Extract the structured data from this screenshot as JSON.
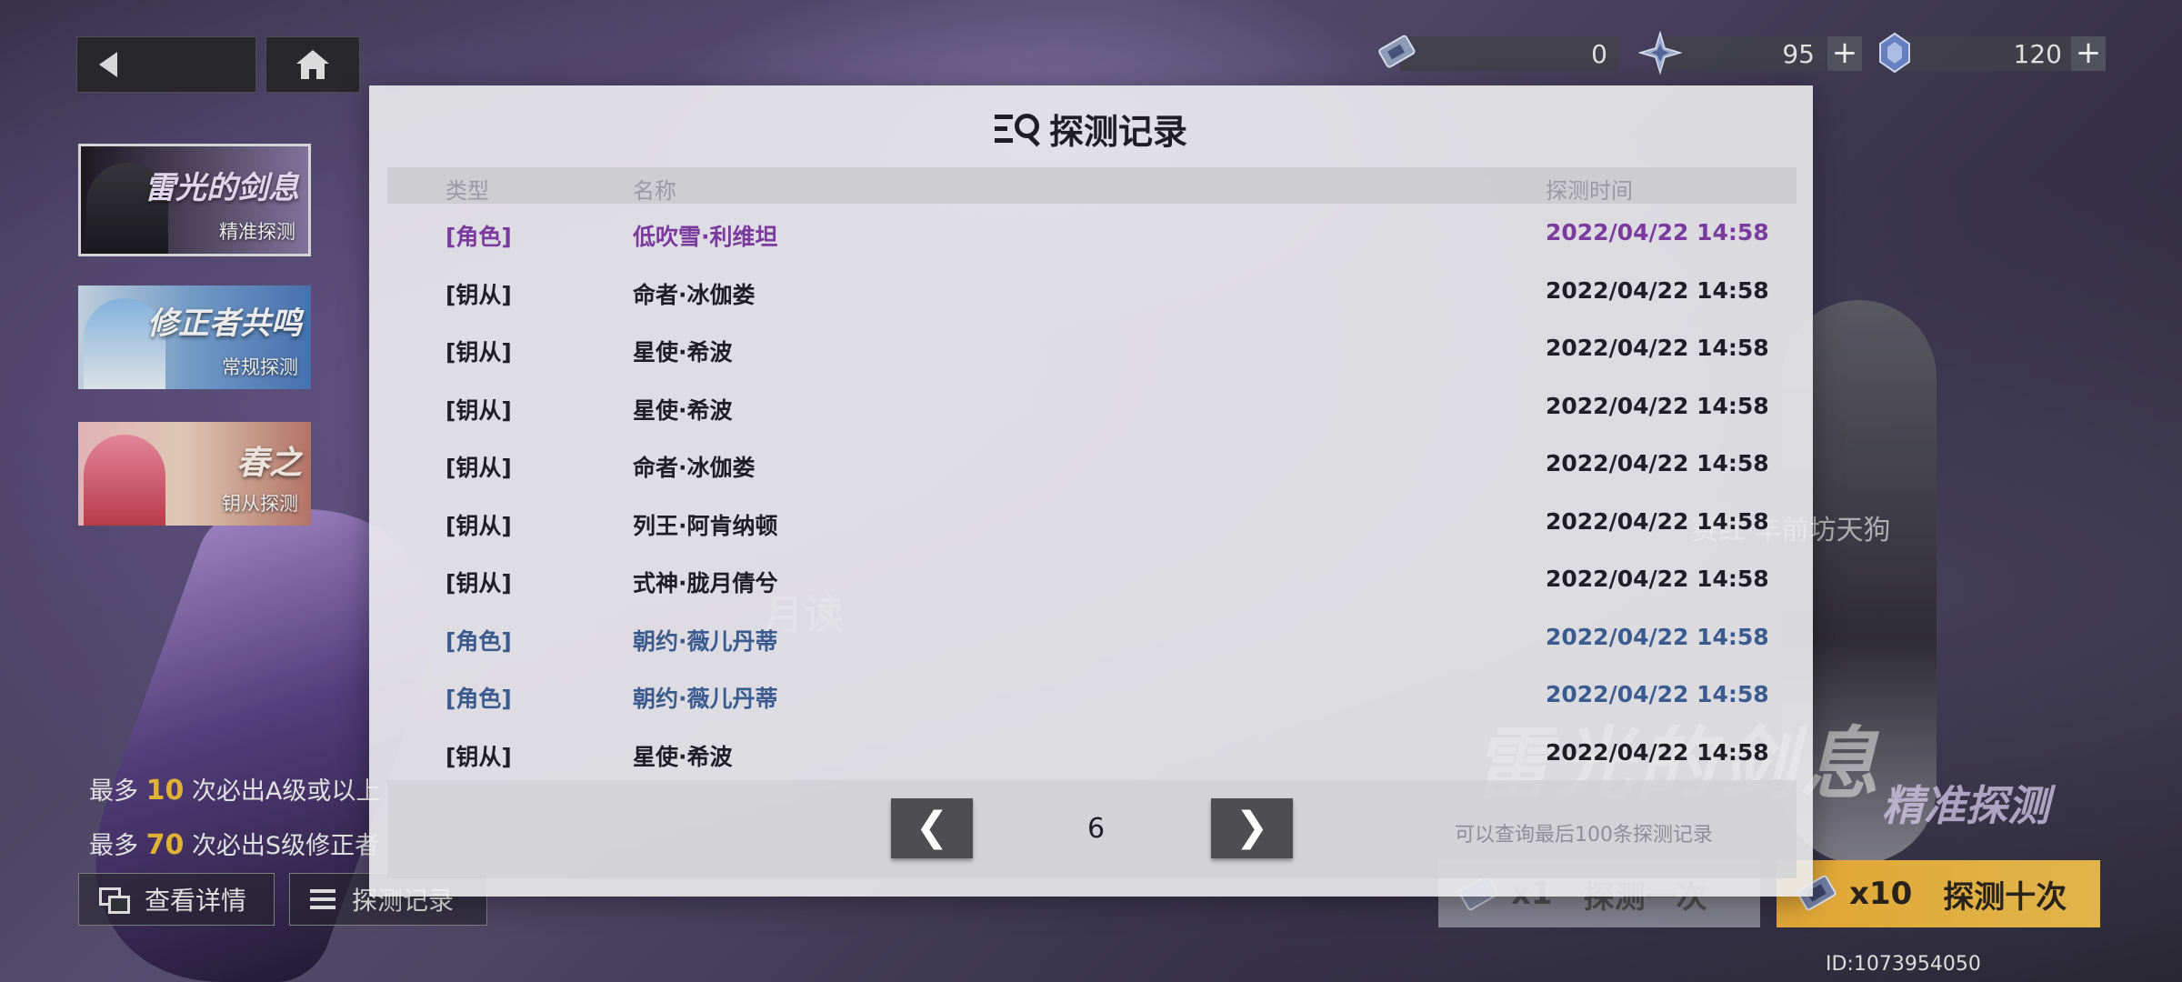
{
  "topbar": {
    "resources": [
      {
        "icon": "ticket-icon",
        "value": "0"
      },
      {
        "icon": "star-crystal-icon",
        "value": "95"
      },
      {
        "icon": "blue-crystal-icon",
        "value": "120"
      }
    ],
    "plus": "+"
  },
  "banners": [
    {
      "title": "雷光的剑息",
      "subtitle": "精准探测"
    },
    {
      "title": "修正者共鸣",
      "subtitle": "常规探测"
    },
    {
      "title": "春之",
      "subtitle": "钥从探测"
    }
  ],
  "guarantees": [
    {
      "prefix": "最多",
      "count": "10",
      "suffix": "次必出A级或以上"
    },
    {
      "prefix": "最多",
      "count": "70",
      "suffix": "次必出S级修正者"
    }
  ],
  "bottom_buttons": {
    "detail": "查看详情",
    "record": "探测记录"
  },
  "draw_buttons": {
    "single": {
      "qty": "x1",
      "label": "探测一次"
    },
    "ten": {
      "qty": "x10",
      "label": "探测十次"
    }
  },
  "user_id": "ID:1073954050",
  "background": {
    "left_tag": "月读",
    "right_tag": "赛红·丰前坊天狗",
    "banner_title": "雷光的剑息",
    "banner_sub": "精准探测"
  },
  "modal": {
    "title": "探测记录",
    "headers": {
      "type": "类型",
      "name": "名称",
      "time": "探测时间"
    },
    "rows": [
      {
        "type": "[角色]",
        "name": "低吹雪·利维坦",
        "time": "2022/04/22 14:58",
        "rarity": "purple"
      },
      {
        "type": "[钥从]",
        "name": "命者·冰伽娄",
        "time": "2022/04/22 14:58",
        "rarity": "normal"
      },
      {
        "type": "[钥从]",
        "name": "星使·希波",
        "time": "2022/04/22 14:58",
        "rarity": "normal"
      },
      {
        "type": "[钥从]",
        "name": "星使·希波",
        "time": "2022/04/22 14:58",
        "rarity": "normal"
      },
      {
        "type": "[钥从]",
        "name": "命者·冰伽娄",
        "time": "2022/04/22 14:58",
        "rarity": "normal"
      },
      {
        "type": "[钥从]",
        "name": "列王·阿肯纳顿",
        "time": "2022/04/22 14:58",
        "rarity": "normal"
      },
      {
        "type": "[钥从]",
        "name": "式神·胧月倩兮",
        "time": "2022/04/22 14:58",
        "rarity": "normal"
      },
      {
        "type": "[角色]",
        "name": "朝约·薇儿丹蒂",
        "time": "2022/04/22 14:58",
        "rarity": "blue"
      },
      {
        "type": "[角色]",
        "name": "朝约·薇儿丹蒂",
        "time": "2022/04/22 14:58",
        "rarity": "blue"
      },
      {
        "type": "[钥从]",
        "name": "星使·希波",
        "time": "2022/04/22 14:58",
        "rarity": "normal"
      }
    ],
    "pager": {
      "prev": "❮",
      "page": "6",
      "next": "❯",
      "note": "可以查询最后100条探测记录"
    }
  },
  "colors": {
    "purple": "#7a3a9e",
    "blue": "#3b5b8f",
    "gold": "#f2c23a",
    "ten_button": "#f5b53a"
  }
}
